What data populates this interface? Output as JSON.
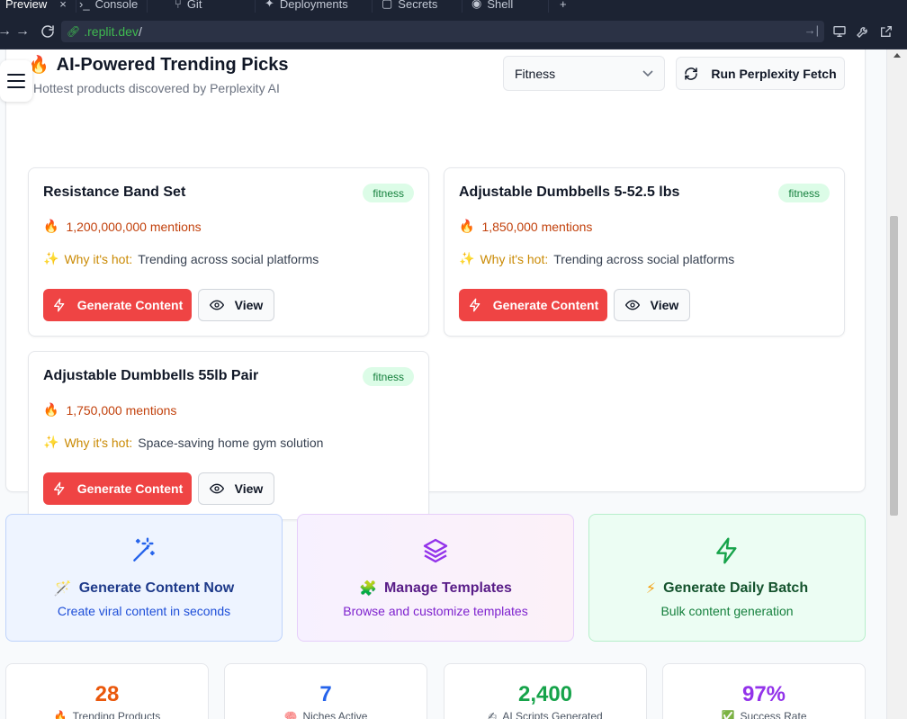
{
  "browser": {
    "tabs": [
      {
        "label": "Preview"
      },
      {
        "label": "Console"
      },
      {
        "label": "Git"
      },
      {
        "label": "Deployments"
      },
      {
        "label": "Secrets"
      },
      {
        "label": "Shell"
      }
    ],
    "url_host": ".replit.dev",
    "url_path": "/"
  },
  "header": {
    "title": "AI-Powered Trending Picks",
    "subtitle": "Hottest products discovered by Perplexity AI",
    "niche_select": "Fitness",
    "run_button": "Run Perplexity Fetch"
  },
  "products": [
    {
      "name": "Resistance Band Set",
      "badge": "fitness",
      "mentions": "1,200,000,000 mentions",
      "why_label": "Why it's hot:",
      "why_text": "Trending across social platforms",
      "generate_label": "Generate Content",
      "view_label": "View"
    },
    {
      "name": "Adjustable Dumbbells 5-52.5 lbs",
      "badge": "fitness",
      "mentions": "1,850,000 mentions",
      "why_label": "Why it's hot:",
      "why_text": "Trending across social platforms",
      "generate_label": "Generate Content",
      "view_label": "View"
    },
    {
      "name": "Adjustable Dumbbells 55lb Pair",
      "badge": "fitness",
      "mentions": "1,750,000 mentions",
      "why_label": "Why it's hot:",
      "why_text": "Space-saving home gym solution",
      "generate_label": "Generate Content",
      "view_label": "View"
    }
  ],
  "actions": [
    {
      "title": "Generate Content Now",
      "desc": "Create viral content in seconds",
      "icon": "magic-wand-icon",
      "color": "#1e40af"
    },
    {
      "title": "Manage Templates",
      "desc": "Browse and customize templates",
      "icon": "layers-icon",
      "color": "#6b21a8"
    },
    {
      "title": "Generate Daily Batch",
      "desc": "Bulk content generation",
      "icon": "lightning-icon",
      "color": "#166534"
    }
  ],
  "stats": [
    {
      "value": "28",
      "label": "Trending Products",
      "color": "#ea580c"
    },
    {
      "value": "7",
      "label": "Niches Active",
      "color": "#2563eb"
    },
    {
      "value": "2,400",
      "label": "AI Scripts Generated",
      "color": "#16a34a"
    },
    {
      "value": "97%",
      "label": "Success Rate",
      "color": "#9333ea"
    }
  ]
}
